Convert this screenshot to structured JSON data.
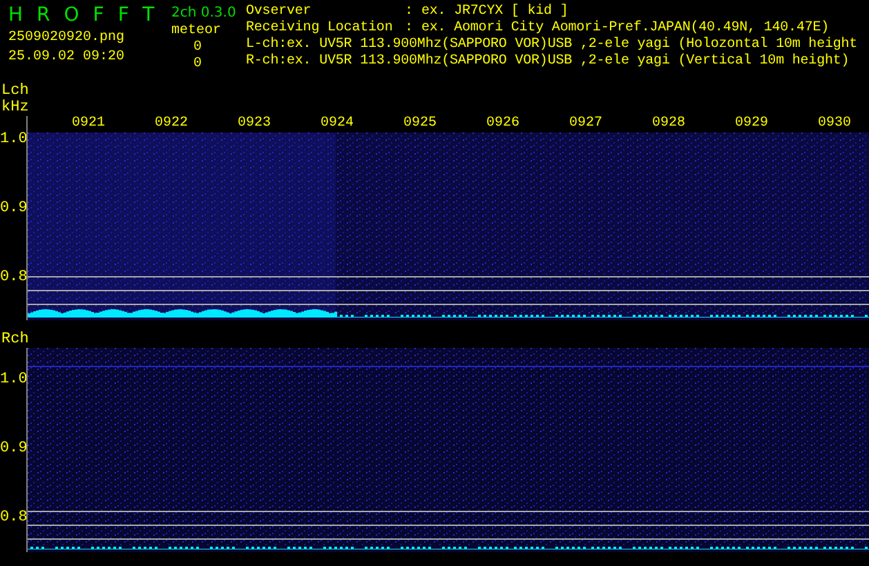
{
  "app": {
    "title": "HROFFT",
    "version": "2ch 0.3.0",
    "file": "2509020920.png",
    "timestamp": "25.09.02 09:20"
  },
  "meteor": {
    "label": "meteor",
    "counts": [
      "0",
      "0"
    ]
  },
  "info": [
    {
      "label": "Ovserver",
      "separator": ":",
      "value": "ex. JR7CYX [ kid ]"
    },
    {
      "label": "Receiving Location",
      "separator": ":",
      "value": "ex. Aomori City Aomori-Pref.JAPAN(40.49N, 140.47E)"
    }
  ],
  "channel_lines": [
    "L-ch:ex. UV5R 113.900Mhz(SAPPORO VOR)USB ,2-ele yagi (Holozontal 10m height",
    "R-ch:ex. UV5R 113.900Mhz(SAPPORO VOR)USB ,2-ele yagi (Vertical 10m height)"
  ],
  "panels": [
    {
      "label": "Lch",
      "unit": "kHz",
      "times": [
        "0921",
        "0922",
        "0923",
        "0924",
        "0925",
        "0926",
        "0927",
        "0928",
        "0929",
        "0930"
      ],
      "y_labels": [
        "1.0",
        "0.9",
        "0.8"
      ]
    },
    {
      "label": "Rch",
      "y_labels": [
        "1.0",
        "0.9",
        "0.8"
      ]
    }
  ]
}
